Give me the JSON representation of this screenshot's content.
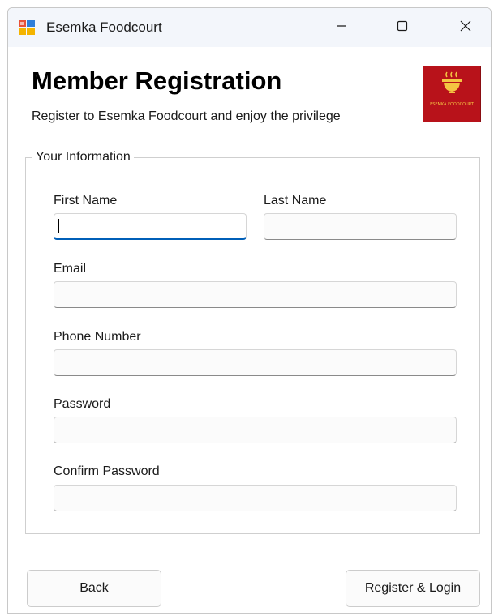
{
  "window": {
    "title": "Esemka Foodcourt"
  },
  "icons": {
    "app": "app-window-icon",
    "minimize": "minimize-icon",
    "maximize": "maximize-icon",
    "close": "close-icon",
    "logo": "foodcourt-logo"
  },
  "header": {
    "title": "Member Registration",
    "subtitle": "Register to Esemka Foodcourt and enjoy the privilege",
    "logo_text": "ESEMKA FOODCOURT"
  },
  "form": {
    "group_label": "Your Information",
    "first_name": {
      "label": "First Name",
      "value": ""
    },
    "last_name": {
      "label": "Last Name",
      "value": ""
    },
    "email": {
      "label": "Email",
      "value": ""
    },
    "phone": {
      "label": "Phone Number",
      "value": ""
    },
    "password": {
      "label": "Password",
      "value": ""
    },
    "confirm_password": {
      "label": "Confirm Password",
      "value": ""
    }
  },
  "buttons": {
    "back": "Back",
    "register": "Register & Login"
  },
  "colors": {
    "focus_accent": "#005fb8",
    "logo_background": "#b8121a",
    "logo_foreground": "#f4c542",
    "titlebar": "#f3f6fb"
  }
}
